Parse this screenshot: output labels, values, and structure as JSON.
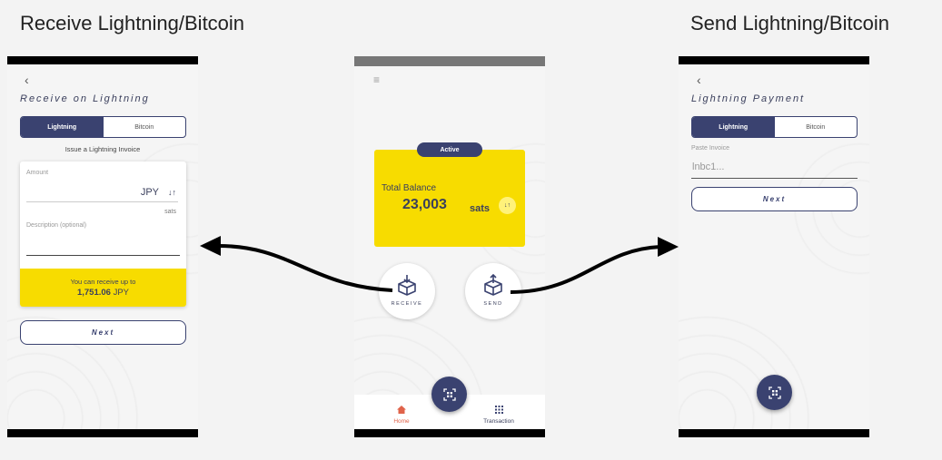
{
  "titles": {
    "receive": "Receive Lightning/Bitcoin",
    "send": "Send Lightning/Bitcoin"
  },
  "receive_screen": {
    "back_glyph": "‹",
    "title": "Receive on Lightning",
    "tabs": [
      "Lightning",
      "Bitcoin"
    ],
    "issue_text": "Issue a Lightning Invoice",
    "amount_label": "Amount",
    "currency": "JPY",
    "swap_glyph": "↓↑",
    "sats_label": "sats",
    "description_label": "Description (optional)",
    "receive_up_to": "You can receive up to",
    "max_amount": "1,751.06",
    "max_currency": "JPY",
    "next_label": "Next"
  },
  "home_screen": {
    "menu_glyph": "≡",
    "status_badge": "Active",
    "total_balance_label": "Total Balance",
    "balance_value": "23,003",
    "balance_unit": "sats",
    "swap_glyph": "↓↑",
    "receive_label": "RECEIVE",
    "send_label": "SEND",
    "nav": {
      "home": "Home",
      "transaction": "Transaction"
    }
  },
  "send_screen": {
    "back_glyph": "‹",
    "title": "Lightning Payment",
    "tabs": [
      "Lightning",
      "Bitcoin"
    ],
    "paste_label": "Paste Invoice",
    "invoice_placeholder": "lnbc1...",
    "next_label": "Next"
  },
  "colors": {
    "navy": "#3a4270",
    "yellow": "#f7dc00",
    "home_active": "#e0634a"
  }
}
